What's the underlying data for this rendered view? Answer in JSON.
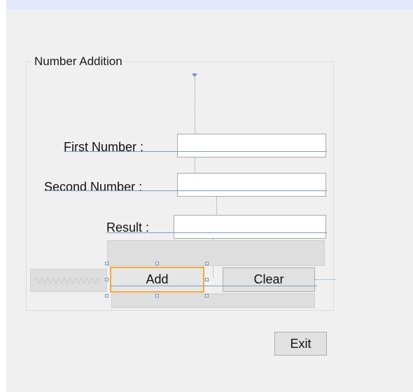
{
  "panel": {
    "group_title": "Number Addition"
  },
  "labels": {
    "first_number": "First Number :",
    "second_number": "Second Number :",
    "result": "Result :"
  },
  "fields": {
    "first_number_value": "",
    "second_number_value": "",
    "result_value": ""
  },
  "buttons": {
    "add": "Add",
    "clear": "Clear",
    "exit": "Exit"
  },
  "colors": {
    "selection_border": "#f2a83b",
    "guide_line": "#7c9cc4",
    "background": "#f0f0f0"
  }
}
